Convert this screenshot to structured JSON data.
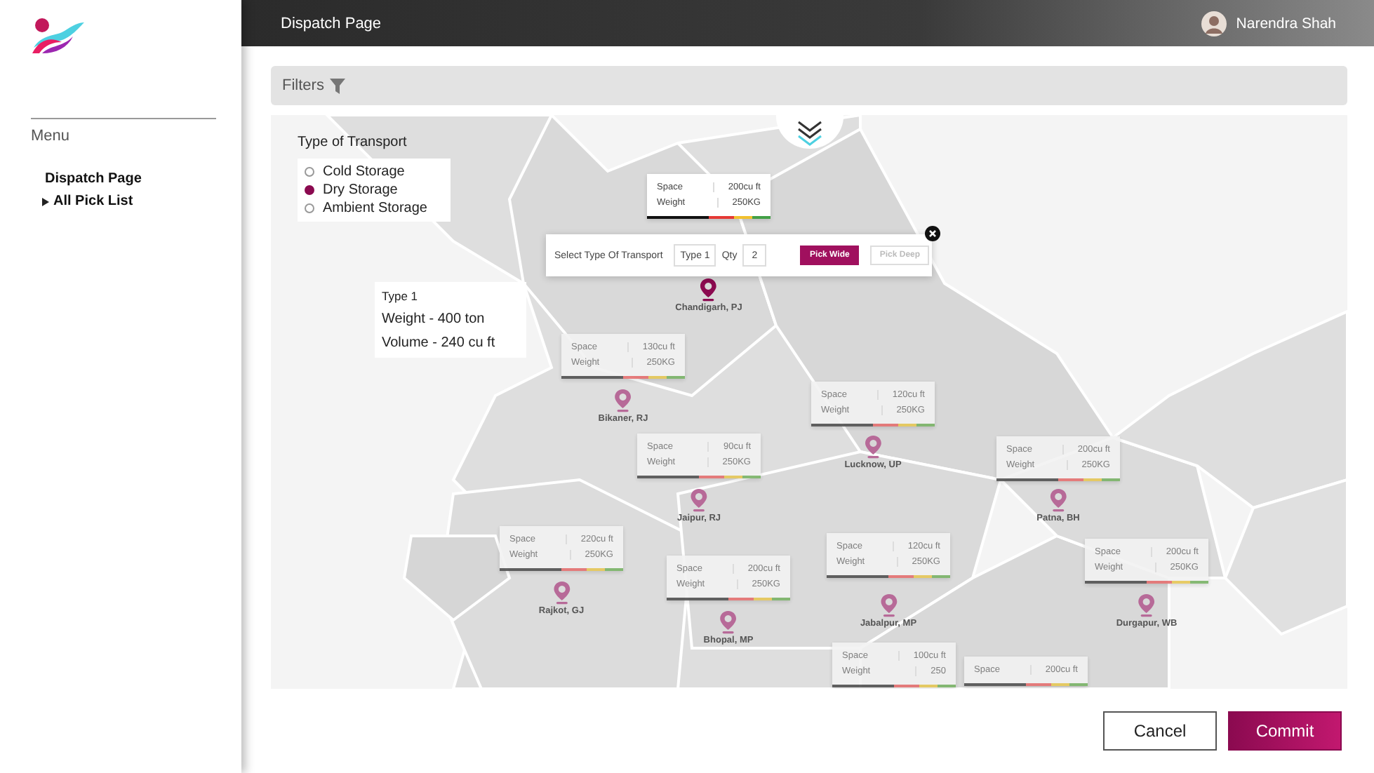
{
  "header": {
    "title": "Dispatch Page",
    "user": "Narendra Shah"
  },
  "sidebar": {
    "menu_label": "Menu",
    "items": [
      {
        "label": "Dispatch Page",
        "kind": "page"
      },
      {
        "label": "All Pick List",
        "kind": "group",
        "expanded": false
      }
    ]
  },
  "filters": {
    "label": "Filters"
  },
  "transport": {
    "title": "Type of Transport",
    "options": [
      {
        "label": "Cold Storage",
        "selected": false
      },
      {
        "label": "Dry Storage",
        "selected": true
      },
      {
        "label": "Ambient Storage",
        "selected": false
      }
    ]
  },
  "type_info": {
    "title": "Type 1",
    "lines": [
      "Weight - 400 ton",
      "Volume - 240 cu ft"
    ]
  },
  "locations": [
    {
      "name": "Chandigarh, PJ",
      "selected": true,
      "rows": [
        {
          "label": "Space",
          "value": "200cu ft"
        },
        {
          "label": "Weight",
          "value": "250KG"
        }
      ]
    },
    {
      "name": "Bikaner, RJ",
      "selected": false,
      "rows": [
        {
          "label": "Space",
          "value": "130cu ft"
        },
        {
          "label": "Weight",
          "value": "250KG"
        }
      ]
    },
    {
      "name": "Lucknow, UP",
      "selected": false,
      "rows": [
        {
          "label": "Space",
          "value": "120cu ft"
        },
        {
          "label": "Weight",
          "value": "250KG"
        }
      ]
    },
    {
      "name": "Jaipur, RJ",
      "selected": false,
      "rows": [
        {
          "label": "Space",
          "value": "90cu ft"
        },
        {
          "label": "Weight",
          "value": "250KG"
        }
      ]
    },
    {
      "name": "Patna, BH",
      "selected": false,
      "rows": [
        {
          "label": "Space",
          "value": "200cu ft"
        },
        {
          "label": "Weight",
          "value": "250KG"
        }
      ]
    },
    {
      "name": "Rajkot, GJ",
      "selected": false,
      "rows": [
        {
          "label": "Space",
          "value": "220cu ft"
        },
        {
          "label": "Weight",
          "value": "250KG"
        }
      ]
    },
    {
      "name": "Bhopal, MP",
      "selected": false,
      "rows": [
        {
          "label": "Space",
          "value": "200cu ft"
        },
        {
          "label": "Weight",
          "value": "250KG"
        }
      ]
    },
    {
      "name": "Jabalpur, MP",
      "selected": false,
      "rows": [
        {
          "label": "Space",
          "value": "120cu ft"
        },
        {
          "label": "Weight",
          "value": "250KG"
        }
      ]
    },
    {
      "name": "Durgapur, WB",
      "selected": false,
      "rows": [
        {
          "label": "Space",
          "value": "200cu ft"
        },
        {
          "label": "Weight",
          "value": "250KG"
        }
      ]
    },
    {
      "selected": false,
      "rows": [
        {
          "label": "Space",
          "value": "100cu ft"
        },
        {
          "label": "Weight",
          "value": "250"
        }
      ]
    },
    {
      "selected": false,
      "rows": [
        {
          "label": "Space",
          "value": "200cu ft"
        }
      ]
    }
  ],
  "popup": {
    "label": "Select Type Of Transport",
    "type_value": "Type 1",
    "qty_label": "Qty",
    "qty_value": "2",
    "buttons": [
      {
        "label": "Pick Wide",
        "kind": "primary"
      },
      {
        "label": "Pick Deep",
        "kind": "secondary"
      }
    ]
  },
  "buttons": [
    {
      "label": "Cancel",
      "kind": "secondary"
    },
    {
      "label": "Commit",
      "kind": "primary"
    }
  ]
}
